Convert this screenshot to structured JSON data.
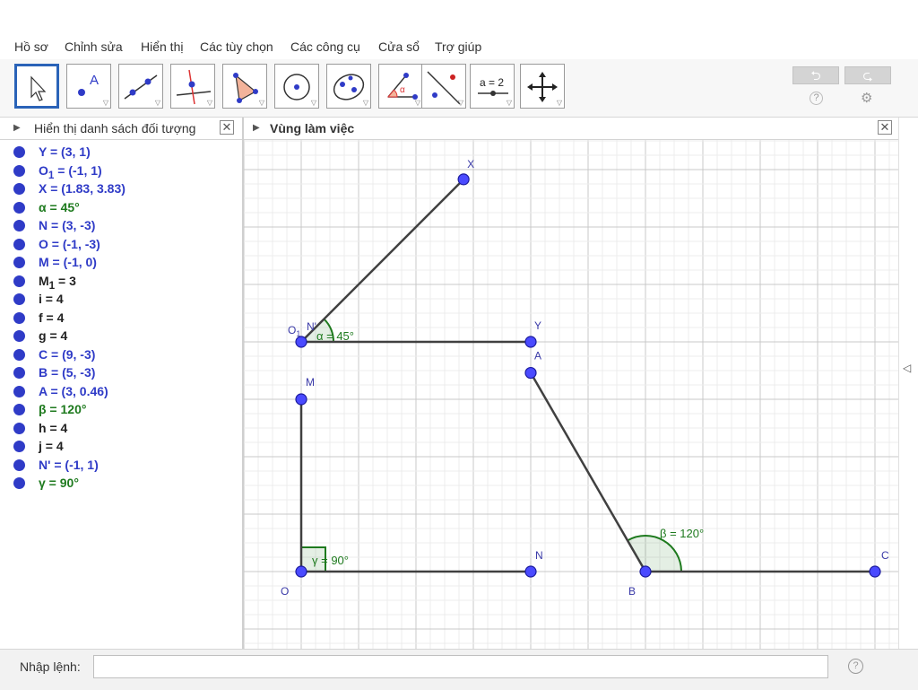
{
  "menu": [
    "Hồ sơ",
    "Chỉnh sửa",
    "Hiển thị",
    "Các tùy chọn",
    "Các công cụ",
    "Cửa sổ",
    "Trợ giúp"
  ],
  "toolbar": {
    "tools": [
      {
        "icon": "move-arrow-icon",
        "selected": true
      },
      {
        "icon": "point-icon",
        "label": "A"
      },
      {
        "icon": "line-icon"
      },
      {
        "icon": "perpendicular-line-icon"
      },
      {
        "icon": "polygon-icon"
      },
      {
        "icon": "circle-icon"
      },
      {
        "icon": "ellipse-icon"
      },
      {
        "icon": "angle-icon",
        "label": "α"
      },
      {
        "icon": "reflect-icon"
      },
      {
        "icon": "slider-icon",
        "label": "a = 2"
      },
      {
        "icon": "move-graphics-view-icon"
      }
    ],
    "undo_icon": "undo-icon",
    "redo_icon": "redo-icon",
    "help_icon": "help-icon",
    "settings_icon": "settings-gear-icon"
  },
  "algebra": {
    "title": "Hiển thị danh sách đối tượng",
    "items": [
      {
        "name": "Y",
        "value": " = (3, 1)",
        "color": "#2f3bc7"
      },
      {
        "name": "O",
        "sub": "1",
        "value": " = (-1, 1)",
        "color": "#2f3bc7"
      },
      {
        "name": "X",
        "value": " = (1.83, 3.83)",
        "color": "#2f3bc7"
      },
      {
        "name": "α",
        "value": " = 45°",
        "color": "#1e7a1e"
      },
      {
        "name": "N",
        "value": " = (3, -3)",
        "color": "#2f3bc7"
      },
      {
        "name": "O",
        "value": " = (-1, -3)",
        "color": "#2f3bc7"
      },
      {
        "name": "M",
        "value": " = (-1, 0)",
        "color": "#2f3bc7"
      },
      {
        "name": "M",
        "sub": "1",
        "value": " = 3",
        "color": "#222222"
      },
      {
        "name": "i",
        "value": " = 4",
        "color": "#222222"
      },
      {
        "name": "f",
        "value": " = 4",
        "color": "#222222"
      },
      {
        "name": "g",
        "value": " = 4",
        "color": "#222222"
      },
      {
        "name": "C",
        "value": " = (9, -3)",
        "color": "#2f3bc7"
      },
      {
        "name": "B",
        "value": " = (5, -3)",
        "color": "#2f3bc7"
      },
      {
        "name": "A",
        "value": " = (3, 0.46)",
        "color": "#2f3bc7"
      },
      {
        "name": "β",
        "value": " = 120°",
        "color": "#1e7a1e"
      },
      {
        "name": "h",
        "value": " = 4",
        "color": "#222222"
      },
      {
        "name": "j",
        "value": " = 4",
        "color": "#222222"
      },
      {
        "name": "N'",
        "value": " = (-1, 1)",
        "color": "#2f3bc7"
      },
      {
        "name": "γ",
        "value": " = 90°",
        "color": "#1e7a1e"
      }
    ]
  },
  "graphics": {
    "title": "Vùng làm việc",
    "points": [
      {
        "id": "X",
        "label": "X",
        "x": 1.83,
        "y": 3.83
      },
      {
        "id": "O1",
        "label": "O",
        "sub": "1",
        "x": -1,
        "y": 1
      },
      {
        "id": "Y",
        "label": "Y",
        "x": 3,
        "y": 1
      },
      {
        "id": "A",
        "label": "A",
        "x": 3,
        "y": 0.46
      },
      {
        "id": "M",
        "label": "M",
        "x": -1,
        "y": 0
      },
      {
        "id": "O",
        "label": "O",
        "x": -1,
        "y": -3
      },
      {
        "id": "N",
        "label": "N",
        "x": 3,
        "y": -3
      },
      {
        "id": "B",
        "label": "B",
        "x": 5,
        "y": -3
      },
      {
        "id": "C",
        "label": "C",
        "x": 9,
        "y": -3
      }
    ],
    "extra_labels": [
      {
        "text": "N'",
        "x": -1,
        "y": 1
      }
    ],
    "segments": [
      [
        "O1",
        "X"
      ],
      [
        "O1",
        "Y"
      ],
      [
        "M",
        "O"
      ],
      [
        "O",
        "N"
      ],
      [
        "A",
        "B"
      ],
      [
        "B",
        "C"
      ]
    ],
    "angles": [
      {
        "label": "α = 45°",
        "vertex": "O1",
        "from": 0,
        "to": 45,
        "kind": "arc"
      },
      {
        "label": "β = 120°",
        "vertex": "B",
        "from": 0,
        "to": 120,
        "kind": "arc"
      },
      {
        "label": "γ = 90°",
        "vertex": "O",
        "from": 0,
        "to": 90,
        "kind": "right"
      }
    ],
    "colors": {
      "point": "#4a4aff",
      "segment": "#404040",
      "angle": "#1e7a1e",
      "label_point": "#3a3aa8"
    }
  },
  "input_bar": {
    "label": "Nhập lệnh:",
    "value": "",
    "help_icon": "help-icon"
  }
}
